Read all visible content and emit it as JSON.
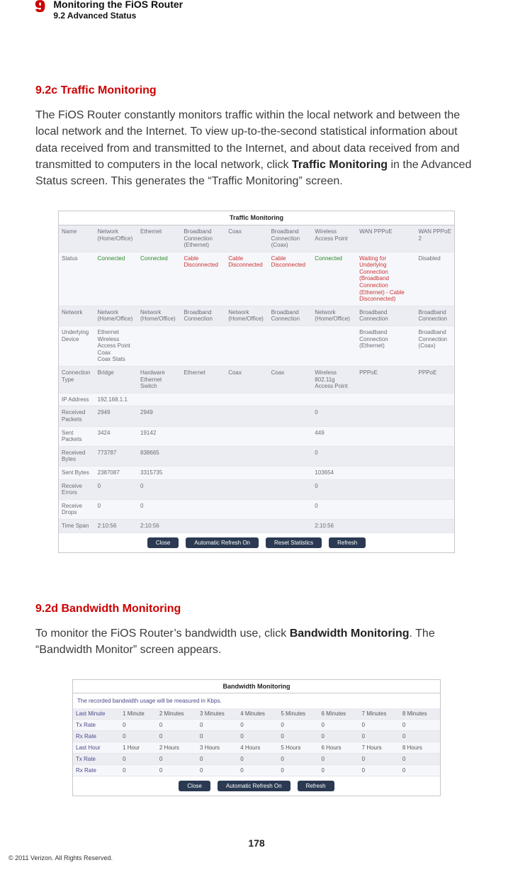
{
  "header": {
    "chapter_num": "9",
    "title": "Monitoring the FiOS Router",
    "subtitle": "9.2  Advanced Status"
  },
  "section_c": {
    "heading": "9.2c  Traffic Monitoring",
    "p_before": "The FiOS Router constantly monitors traffic within the local network and between the local network and the Internet. To view up-to-the-second statistical information about data received from and transmitted to the Internet, and about data received from and transmitted to computers in the local network, click ",
    "p_bold": "Traffic Monitoring",
    "p_after": " in the Advanced Status screen. This generates the “Traffic Monitoring” screen."
  },
  "traffic_panel": {
    "title": "Traffic Monitoring",
    "buttons": [
      "Close",
      "Automatic Refresh On",
      "Reset Statistics",
      "Refresh"
    ],
    "rows": [
      {
        "label": "Name",
        "cells": [
          "Network (Home/Office)",
          "Ethernet",
          "Broadband Connection (Ethernet)",
          "Coax",
          "Broadband Connection (Coax)",
          "Wireless Access Point",
          "WAN PPPoE",
          "WAN PPPoE 2"
        ]
      },
      {
        "label": "Status",
        "cells": [
          {
            "t": "Connected",
            "c": "green"
          },
          {
            "t": "Connected",
            "c": "green"
          },
          {
            "t": "Cable Disconnected",
            "c": "red"
          },
          {
            "t": "Cable Disconnected",
            "c": "red"
          },
          {
            "t": "Cable Disconnected",
            "c": "red"
          },
          {
            "t": "Connected",
            "c": "green"
          },
          {
            "t": "Waiting for Underlying Connection (Broadband Connection (Ethernet) - Cable Disconnected)",
            "c": "red"
          },
          {
            "t": "Disabled",
            "c": ""
          }
        ]
      },
      {
        "label": "Network",
        "cells": [
          "Network (Home/Office)",
          "Network (Home/Office)",
          "Broadband Connection",
          "Network (Home/Office)",
          "Broadband Connection",
          "Network (Home/Office)",
          "Broadband Connection",
          "Broadband Connection"
        ]
      },
      {
        "label": "Underlying Device",
        "cells": [
          "Ethernet\nWireless Access Point\nCoax\nCoax Stats",
          "",
          "",
          "",
          "",
          "",
          "Broadband Connection (Ethernet)",
          "Broadband Connection (Coax)"
        ]
      },
      {
        "label": "Connection Type",
        "cells": [
          "Bridge",
          "Hardware Ethernet Switch",
          "Ethernet",
          "Coax",
          "Coax",
          "Wireless 802.11g Access Point",
          "PPPoE",
          "PPPoE"
        ]
      },
      {
        "label": "IP Address",
        "cells": [
          "192.168.1.1",
          "",
          "",
          "",
          "",
          "",
          "",
          ""
        ]
      },
      {
        "label": "Received Packets",
        "cells": [
          "2949",
          "2949",
          "",
          "",
          "",
          "0",
          "",
          ""
        ]
      },
      {
        "label": "Sent Packets",
        "cells": [
          "3424",
          "19142",
          "",
          "",
          "",
          "449",
          "",
          ""
        ]
      },
      {
        "label": "Received Bytes",
        "cells": [
          "773787",
          "838665",
          "",
          "",
          "",
          "0",
          "",
          ""
        ]
      },
      {
        "label": "Sent Bytes",
        "cells": [
          "2387087",
          "3315735",
          "",
          "",
          "",
          "103654",
          "",
          ""
        ]
      },
      {
        "label": "Receive Errors",
        "cells": [
          "0",
          "0",
          "",
          "",
          "",
          "0",
          "",
          ""
        ]
      },
      {
        "label": "Receive Drops",
        "cells": [
          "0",
          "0",
          "",
          "",
          "",
          "0",
          "",
          ""
        ]
      },
      {
        "label": "Time Span",
        "cells": [
          "2:10:56",
          "2:10:56",
          "",
          "",
          "",
          "2:10:56",
          "",
          ""
        ]
      }
    ]
  },
  "section_d": {
    "heading": "9.2d  Bandwidth Monitoring",
    "p_before": "To monitor the FiOS Router’s bandwidth use, click ",
    "p_bold": "Bandwidth Monitoring",
    "p_after": ". The “Bandwidth Monitor” screen appears."
  },
  "bw_panel": {
    "title": "Bandwidth Monitoring",
    "note": "The recorded bandwidth usage will be measured in Kbps.",
    "buttons": [
      "Close",
      "Automatic Refresh On",
      "Refresh"
    ],
    "rows": [
      {
        "label": "Last Minute",
        "cells": [
          "1 Minute",
          "2 Minutes",
          "3 Minutes",
          "4 Minutes",
          "5 Minutes",
          "6 Minutes",
          "7 Minutes",
          "8 Minutes"
        ]
      },
      {
        "label": "Tx Rate",
        "cells": [
          "0",
          "0",
          "0",
          "0",
          "0",
          "0",
          "0",
          "0"
        ]
      },
      {
        "label": "Rx Rate",
        "cells": [
          "0",
          "0",
          "0",
          "0",
          "0",
          "0",
          "0",
          "0"
        ]
      },
      {
        "label": "Last Hour",
        "cells": [
          "1 Hour",
          "2 Hours",
          "3 Hours",
          "4 Hours",
          "5 Hours",
          "6 Hours",
          "7 Hours",
          "8 Hours"
        ]
      },
      {
        "label": "Tx Rate",
        "cells": [
          "0",
          "0",
          "0",
          "0",
          "0",
          "0",
          "0",
          "0"
        ]
      },
      {
        "label": "Rx Rate",
        "cells": [
          "0",
          "0",
          "0",
          "0",
          "0",
          "0",
          "0",
          "0"
        ]
      }
    ]
  },
  "page_number": "178",
  "copyright": "© 2011 Verizon. All Rights Reserved."
}
